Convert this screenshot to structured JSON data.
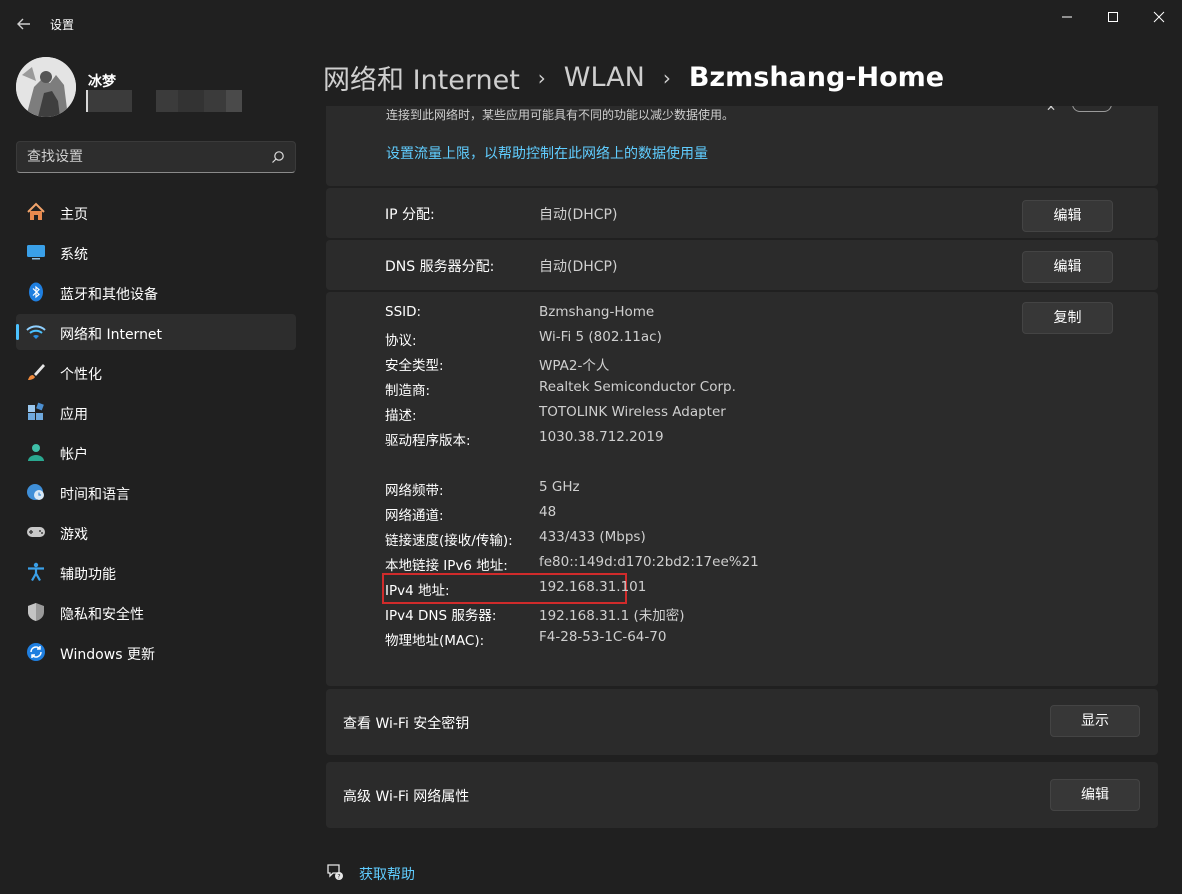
{
  "window": {
    "title": "设置"
  },
  "user": {
    "name": "冰梦"
  },
  "search": {
    "placeholder": "查找设置"
  },
  "sidebar": {
    "items": [
      {
        "label": "主页",
        "icon": "home-icon"
      },
      {
        "label": "系统",
        "icon": "system-monitor-icon"
      },
      {
        "label": "蓝牙和其他设备",
        "icon": "bluetooth-icon"
      },
      {
        "label": "网络和 Internet",
        "icon": "wifi-icon",
        "active": true
      },
      {
        "label": "个性化",
        "icon": "brush-icon"
      },
      {
        "label": "应用",
        "icon": "apps-icon"
      },
      {
        "label": "帐户",
        "icon": "person-icon"
      },
      {
        "label": "时间和语言",
        "icon": "globe-clock-icon"
      },
      {
        "label": "游戏",
        "icon": "gamepad-icon"
      },
      {
        "label": "辅助功能",
        "icon": "accessibility-icon"
      },
      {
        "label": "隐私和安全性",
        "icon": "shield-icon"
      },
      {
        "label": "Windows 更新",
        "icon": "update-icon"
      }
    ]
  },
  "breadcrumb": {
    "level1": "网络和 Internet",
    "level2": "WLAN",
    "current": "Bzmshang-Home"
  },
  "metered": {
    "description": "连接到此网络时，某些应用可能具有不同的功能以减少数据使用。",
    "link": "设置流量上限，以帮助控制在此网络上的数据使用量"
  },
  "ip_assignment": {
    "label": "IP 分配:",
    "value": "自动(DHCP)",
    "button": "编辑"
  },
  "dns_assignment": {
    "label": "DNS 服务器分配:",
    "value": "自动(DHCP)",
    "button": "编辑"
  },
  "properties": {
    "copy_button": "复制",
    "rows": [
      {
        "label": "SSID:",
        "value": "Bzmshang-Home"
      },
      {
        "label": "协议:",
        "value": "Wi-Fi 5 (802.11ac)"
      },
      {
        "label": "安全类型:",
        "value": "WPA2-个人"
      },
      {
        "label": "制造商:",
        "value": "Realtek Semiconductor Corp."
      },
      {
        "label": "描述:",
        "value": "TOTOLINK Wireless Adapter"
      },
      {
        "label": "驱动程序版本:",
        "value": "1030.38.712.2019"
      },
      {
        "label": "网络频带:",
        "value": "5 GHz"
      },
      {
        "label": "网络通道:",
        "value": "48"
      },
      {
        "label": "链接速度(接收/传输):",
        "value": "433/433 (Mbps)"
      },
      {
        "label": "本地链接 IPv6 地址:",
        "value": "fe80::149d:d170:2bd2:17ee%21"
      },
      {
        "label": "IPv4 地址:",
        "value": "192.168.31.101"
      },
      {
        "label": "IPv4 DNS 服务器:",
        "value": "192.168.31.1 (未加密)"
      },
      {
        "label": "物理地址(MAC):",
        "value": "F4-28-53-1C-64-70"
      }
    ]
  },
  "security_key": {
    "label": "查看 Wi-Fi 安全密钥",
    "button": "显示"
  },
  "advanced": {
    "label": "高级 Wi-Fi 网络属性",
    "button": "编辑"
  },
  "help": {
    "label": "获取帮助"
  },
  "colors": {
    "accent": "#4cc2ff",
    "link": "#60cdff",
    "highlight": "#d02b2b",
    "background": "#202020",
    "card": "#2b2b2b"
  }
}
